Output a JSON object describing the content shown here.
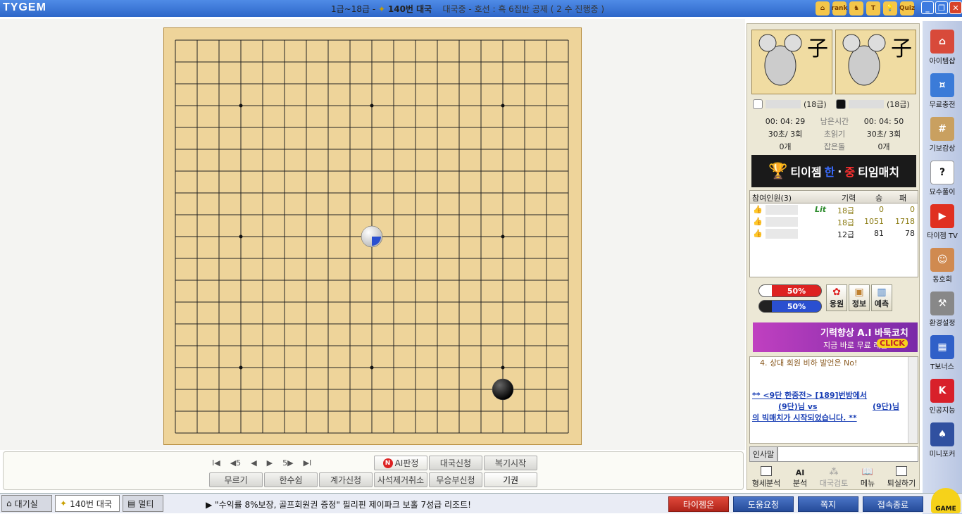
{
  "title": {
    "logo": "TYGEM",
    "prefix": "1급~18급 - ",
    "game": "140번 대국",
    "status": "대국중 - 호선 : 흑 6집반 공제 ( 2 수 진행중 )"
  },
  "topicons": [
    {
      "icon": "home-icon",
      "label": "⌂"
    },
    {
      "icon": "rank-icon",
      "label": "rank"
    },
    {
      "icon": "mouse-icon",
      "label": "♞"
    },
    {
      "icon": "t-icon",
      "label": "T"
    },
    {
      "icon": "bulb-icon",
      "label": "💡"
    },
    {
      "icon": "quiz-icon",
      "label": "Quiz"
    }
  ],
  "board": {
    "size": 19,
    "stones": [
      {
        "col": 9,
        "row": 9,
        "color": "white"
      },
      {
        "col": 15,
        "row": 16,
        "color": "black"
      }
    ]
  },
  "nav": {
    "first": "I◀",
    "back5": "◀5",
    "prev": "◀",
    "next": "▶",
    "fwd5": "5▶",
    "last": "▶I"
  },
  "buttons": {
    "ai": "AI판정",
    "apply": "대국신청",
    "review": "복기시작",
    "undo": "무르기",
    "pass": "한수쉼",
    "count": "계가신청",
    "remove_dead": "사석제거취소",
    "draw": "무승부신청",
    "resign": "기권"
  },
  "players": {
    "white": {
      "name": "",
      "rank": "(18급)",
      "time": "00: 04: 29",
      "byoyomi": "30초/ 3회",
      "captured": "0개"
    },
    "black": {
      "name": "",
      "rank": "(18급)",
      "time": "00: 04: 50",
      "byoyomi": "30초/ 3회",
      "captured": "0개"
    },
    "labels": {
      "remaining": "남은시간",
      "byoyomi": "초읽기",
      "captured": "잡은돌"
    }
  },
  "avatar_char": "子",
  "banner": {
    "part1": "티이젬",
    "han": "한",
    "dot": "·",
    "jung": "중",
    "part2": "티임매치"
  },
  "members": {
    "header": {
      "name": "참여인원(3)",
      "rank": "기력",
      "win": "승",
      "lose": "패"
    },
    "rows": [
      {
        "rank": "18급",
        "win": "0",
        "lose": "0",
        "badge": "Lit"
      },
      {
        "rank": "18급",
        "win": "1051",
        "lose": "1718",
        "badge": ""
      },
      {
        "rank": "12급",
        "win": "81",
        "lose": "78",
        "badge": ""
      }
    ]
  },
  "winrate": {
    "white": "50%",
    "black": "50%"
  },
  "sqbtns": {
    "cheer": "응원",
    "info": "정보",
    "predict": "예측"
  },
  "ad": {
    "title": "기력향상 A.I 바둑코치",
    "sub": "지금 바로 무료 레슨",
    "cta": "CLICK"
  },
  "chat": {
    "line1": "4. 상대 회원 비하 발언은 No!",
    "link1": "** <9단 한중전> [189]번방에서",
    "link2": "(9단)님 vs",
    "link3": "(9단)님",
    "link4": "의 빅매치가 시작되었습니다. **"
  },
  "chatlabel": "인사말",
  "tools": {
    "analysis": "형세분석",
    "ai": "분석",
    "review": "대국검토",
    "menu": "메뉴",
    "exit": "퇴실하기"
  },
  "tabs": {
    "lobby": "대기실",
    "game": "140번 대국",
    "multi": "멀티"
  },
  "ticker": "▶ \"수익률 8%보장, 골프회원권 증정\" 필리핀 제이파크 보홀 7성급 리조트!",
  "bottombtns": {
    "tygem_on": "타이젬온",
    "help": "도움요청",
    "note": "쪽지",
    "quit": "접속종료"
  },
  "sidebar": [
    {
      "label": "아이템샵",
      "icon": "shop-icon",
      "color": "#d84a3a"
    },
    {
      "label": "무료충전",
      "icon": "coin-icon",
      "color": "#3b7bd8"
    },
    {
      "label": "기보감상",
      "icon": "board-icon",
      "color": "#c9a060"
    },
    {
      "label": "묘수풀이",
      "icon": "question-icon",
      "color": "#ffffff"
    },
    {
      "label": "타이젬 TV",
      "icon": "play-icon",
      "color": "#e03020"
    },
    {
      "label": "동호회",
      "icon": "people-icon",
      "color": "#d08a50"
    },
    {
      "label": "환경설정",
      "icon": "wrench-icon",
      "color": "#888888"
    },
    {
      "label": "T보너스",
      "icon": "gift-icon",
      "color": "#3060c8"
    },
    {
      "label": "인공지능",
      "icon": "katago-icon",
      "color": "#d8202a"
    },
    {
      "label": "미니포커",
      "icon": "card-icon",
      "color": "#3050a0"
    }
  ],
  "game_label": "GAME"
}
